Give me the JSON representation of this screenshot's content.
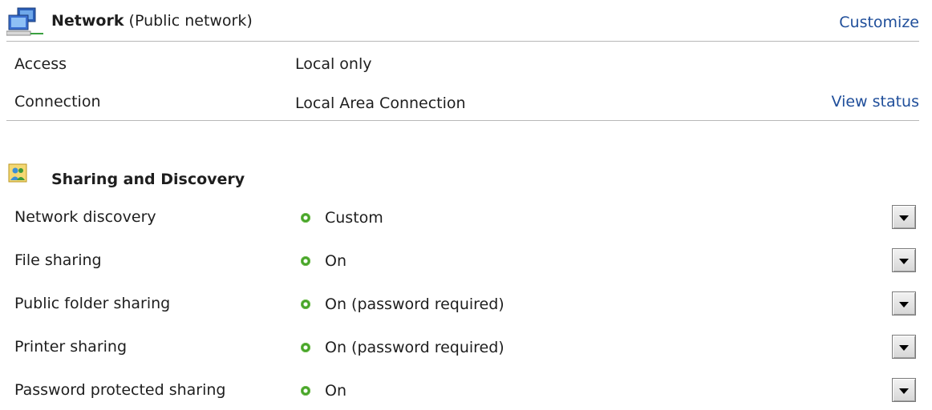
{
  "network": {
    "name": "Network",
    "type": "(Public network)",
    "customize_label": "Customize",
    "rows": [
      {
        "label": "Access",
        "value": "Local only"
      },
      {
        "label": "Connection",
        "value": "Local Area Connection",
        "action": "View status"
      }
    ]
  },
  "sharing": {
    "title": "Sharing and Discovery",
    "status_color": "#4fae2e",
    "items": [
      {
        "label": "Network discovery",
        "status": "Custom"
      },
      {
        "label": "File sharing",
        "status": "On"
      },
      {
        "label": "Public folder sharing",
        "status": "On (password required)"
      },
      {
        "label": "Printer sharing",
        "status": "On (password required)"
      },
      {
        "label": "Password protected sharing",
        "status": "On"
      }
    ]
  },
  "icons": {
    "network": "network-computers-icon",
    "sharing": "sharing-discovery-icon",
    "status": "green-status-dot-icon",
    "dropdown": "chevron-down-icon"
  },
  "colors": {
    "link": "#1f4e9a",
    "divider": "#b8b8b8"
  }
}
